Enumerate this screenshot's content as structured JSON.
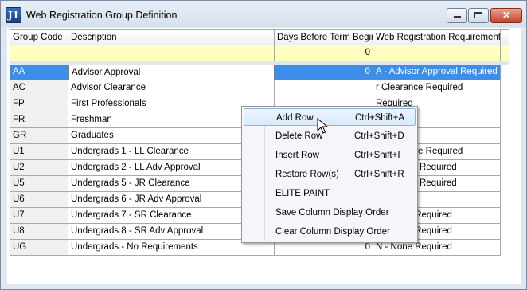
{
  "window": {
    "title": "Web Registration Group Definition",
    "icon_text": "J1",
    "buttons": {
      "minimize": "minimize",
      "maximize": "maximize",
      "close": "✕"
    }
  },
  "grid": {
    "columns": [
      "Group Code",
      "Description",
      "Days Before Term Begin",
      "Web Registration Requirement"
    ],
    "filter_row": {
      "days": "0"
    },
    "rows": [
      {
        "code": "AA",
        "description": "Advisor Approval",
        "days": "0",
        "requirement": "A - Advisor Approval Required"
      },
      {
        "code": "AC",
        "description": "Advisor Clearance",
        "days": "",
        "requirement": "r Clearance Required"
      },
      {
        "code": "FP",
        "description": "First Professionals",
        "days": "",
        "requirement": "Required"
      },
      {
        "code": "FR",
        "description": "Freshman",
        "days": "",
        "requirement": "Required"
      },
      {
        "code": "GR",
        "description": "Graduates",
        "days": "",
        "requirement": "Required"
      },
      {
        "code": "U1",
        "description": "Undergrads 1 - LL Clearance",
        "days": "",
        "requirement": "r Clearance Required"
      },
      {
        "code": "U2",
        "description": "Undergrads 2 - LL Adv Approval",
        "days": "",
        "requirement": "r Approval Required"
      },
      {
        "code": "U5",
        "description": "Undergrads 5 - JR Clearance",
        "days": "",
        "requirement": "r Approval Required"
      },
      {
        "code": "U6",
        "description": "Undergrads 6 - JR Adv Approval",
        "days": "",
        "requirement": "Required"
      },
      {
        "code": "U7",
        "description": "Undergrads 7 - SR Clearance",
        "days": "",
        "requirement": "N - None Required"
      },
      {
        "code": "U8",
        "description": "Undergrads 8 - SR Adv Approval",
        "days": "0",
        "requirement": "N - None Required"
      },
      {
        "code": "UG",
        "description": "Undergrads  - No Requirements",
        "days": "0",
        "requirement": "N - None Required"
      }
    ]
  },
  "context_menu": {
    "items": [
      {
        "label": "Add Row",
        "shortcut": "Ctrl+Shift+A"
      },
      {
        "label": "Delete Row",
        "shortcut": "Ctrl+Shift+D"
      },
      {
        "label": "Insert Row",
        "shortcut": "Ctrl+Shift+I"
      },
      {
        "label": "Restore Row(s)",
        "shortcut": "Ctrl+Shift+R"
      },
      {
        "label": "ELITE PAINT",
        "shortcut": ""
      },
      {
        "label": "Save Column Display Order",
        "shortcut": ""
      },
      {
        "label": "Clear Column Display Order",
        "shortcut": ""
      }
    ]
  },
  "colors": {
    "selection": "#3d8ee9",
    "filter_row": "#ffffc0",
    "chrome": "#dfe7f1"
  },
  "icons": [
    "app-j1-icon",
    "minimize-icon",
    "maximize-icon",
    "close-icon",
    "mouse-pointer-icon"
  ]
}
